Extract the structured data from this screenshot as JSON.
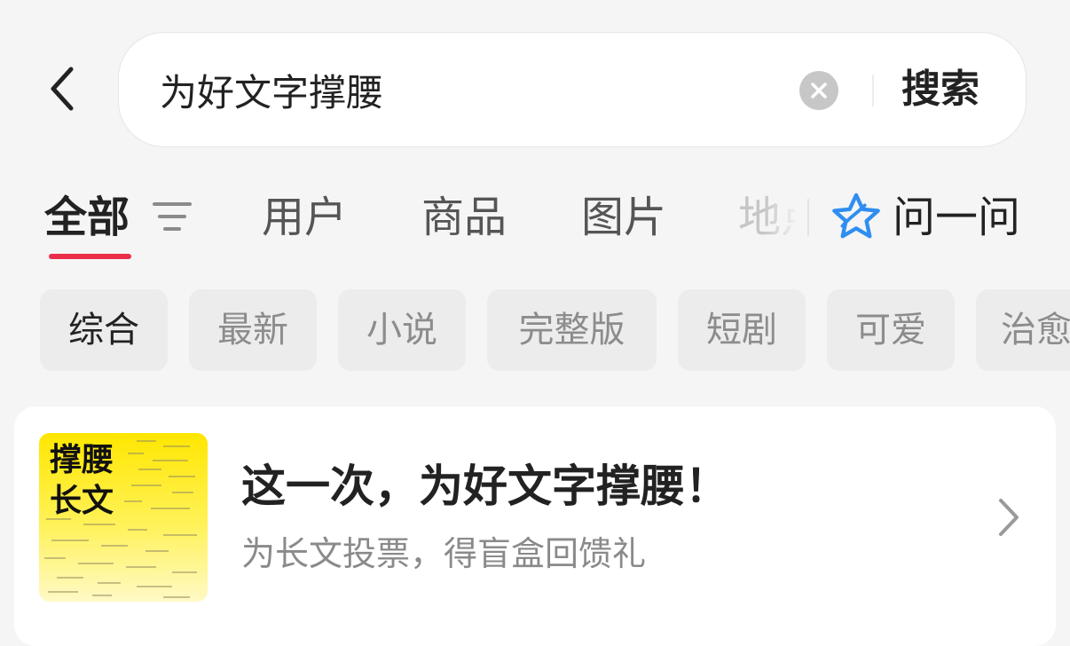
{
  "header": {
    "search_value": "为好文字撑腰",
    "search_button_label": "搜索"
  },
  "tabs": {
    "items": [
      {
        "label": "全部",
        "active": true
      },
      {
        "label": "用户",
        "active": false
      },
      {
        "label": "商品",
        "active": false
      },
      {
        "label": "图片",
        "active": false
      },
      {
        "label": "地点",
        "active": false
      }
    ],
    "ask_label": "问一问"
  },
  "filter_chips": [
    {
      "label": "综合",
      "active": true
    },
    {
      "label": "最新",
      "active": false
    },
    {
      "label": "小说",
      "active": false
    },
    {
      "label": "完整版",
      "active": false
    },
    {
      "label": "短剧",
      "active": false
    },
    {
      "label": "可爱",
      "active": false
    },
    {
      "label": "治愈",
      "active": false
    }
  ],
  "promo_card": {
    "thumbnail_text": [
      "撑腰",
      "长文"
    ],
    "title": "这一次，为好文字撑腰！",
    "subtitle": "为长文投票，得盲盒回馈礼"
  },
  "colors": {
    "accent": "#ea2e49",
    "ask_icon": "#2f8ef0",
    "thumbnail_yellow": "#ffe600",
    "page_background": "#f5f5f5"
  },
  "icons": {
    "back": "chevron-left-icon",
    "clear": "clear-icon",
    "filter": "filter-icon",
    "ask": "sparkle-star-icon",
    "card_arrow": "chevron-right-icon"
  }
}
